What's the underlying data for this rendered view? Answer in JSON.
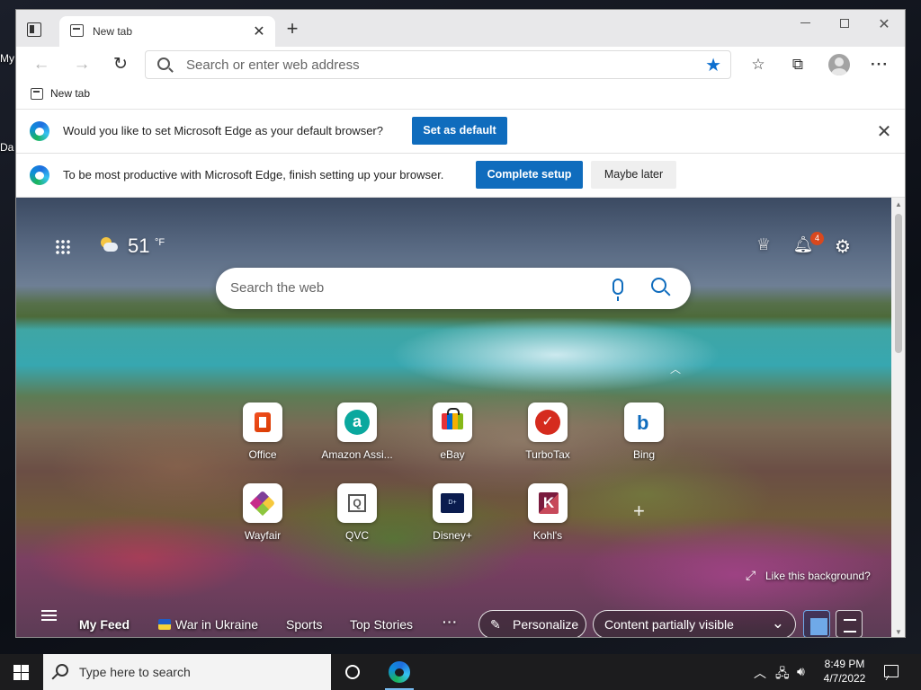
{
  "desktop": {
    "icon_label_1": "My",
    "icon_label_2": "Da"
  },
  "browser": {
    "tab_title": "New tab",
    "address_placeholder": "Search or enter web address",
    "favorites_bar": [
      {
        "label": "New tab"
      }
    ],
    "info_bars": [
      {
        "message": "Would you like to set Microsoft Edge as your default browser?",
        "primary_button": "Set as default"
      },
      {
        "message": "To be most productive with Microsoft Edge, finish setting up your browser.",
        "primary_button": "Complete setup",
        "secondary_button": "Maybe later"
      }
    ]
  },
  "ntp": {
    "weather": {
      "temperature": "51",
      "unit": "°F"
    },
    "notification_count": "4",
    "search_placeholder": "Search the web",
    "quick_links": [
      {
        "label": "Office",
        "icon": "office-icon"
      },
      {
        "label": "Amazon Assi...",
        "icon": "amazon-assistant-icon"
      },
      {
        "label": "eBay",
        "icon": "ebay-icon"
      },
      {
        "label": "TurboTax",
        "icon": "turbotax-icon"
      },
      {
        "label": "Bing",
        "icon": "bing-icon"
      },
      {
        "label": "Wayfair",
        "icon": "wayfair-icon"
      },
      {
        "label": "QVC",
        "icon": "qvc-icon"
      },
      {
        "label": "Disney+",
        "icon": "disney-plus-icon"
      },
      {
        "label": "Kohl's",
        "icon": "kohls-icon"
      }
    ],
    "like_background": "Like this background?",
    "feed_nav": {
      "items": [
        "My Feed",
        "War in Ukraine",
        "Sports",
        "Top Stories"
      ],
      "more": "···",
      "personalize": "Personalize",
      "content_visibility": "Content partially visible"
    }
  },
  "taskbar": {
    "search_placeholder": "Type here to search",
    "time": "8:49 PM",
    "date": "4/7/2022"
  },
  "colors": {
    "accent": "#0f6cbd",
    "badge": "#d9481e",
    "taskbar": "#1c1c1e"
  }
}
